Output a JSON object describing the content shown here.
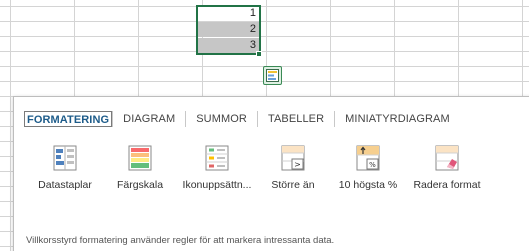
{
  "sheet": {
    "values": [
      "1",
      "2",
      "3"
    ]
  },
  "quick_analysis": {
    "button_icon": "quick-analysis-icon",
    "tabs": [
      {
        "label": "FORMATERING",
        "active": true
      },
      {
        "label": "DIAGRAM",
        "active": false
      },
      {
        "label": "SUMMOR",
        "active": false
      },
      {
        "label": "TABELLER",
        "active": false
      },
      {
        "label": "MINIATYRDIAGRAM",
        "active": false
      }
    ],
    "tools": [
      {
        "label": "Datastaplar",
        "icon": "data-bars-icon"
      },
      {
        "label": "Färgskala",
        "icon": "color-scale-icon"
      },
      {
        "label": "Ikonuppsättn...",
        "icon": "icon-set-icon"
      },
      {
        "label": "Större än",
        "icon": "greater-than-icon"
      },
      {
        "label": "10 högsta %",
        "icon": "top-ten-percent-icon"
      },
      {
        "label": "Radera format",
        "icon": "clear-format-icon"
      }
    ],
    "description": "Villkorsstyrd formatering använder regler för att markera intressanta data."
  },
  "colors": {
    "selection_border": "#217346",
    "selection_fill": "#c6c6c6",
    "active_tab_text": "#1e5c8a"
  }
}
